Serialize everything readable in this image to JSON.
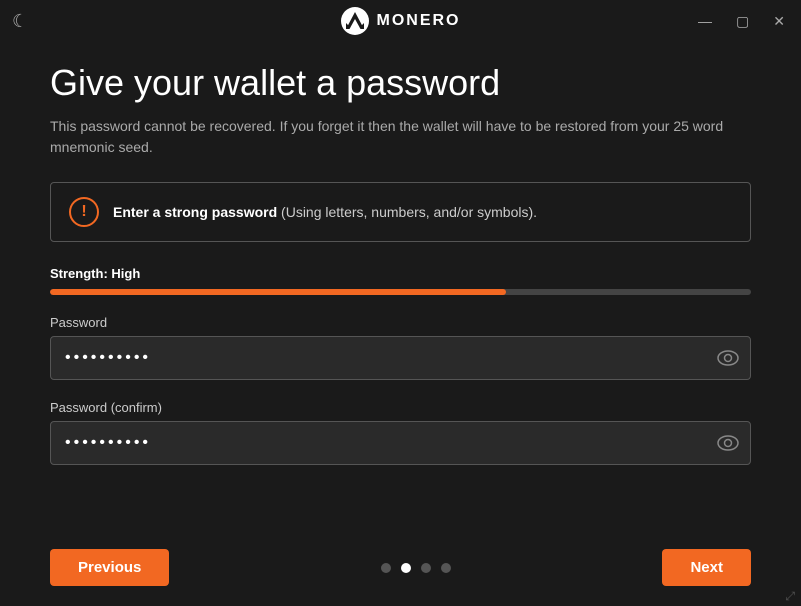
{
  "titleBar": {
    "appName": "MONERO",
    "minimizeLabel": "—",
    "maximizeLabel": "▢",
    "closeLabel": "✕"
  },
  "page": {
    "title": "Give your wallet a password",
    "subtitle": "This password cannot be recovered. If you forget it then the wallet will have to be restored from your 25 word mnemonic seed.",
    "warningText_strong": "Enter a strong password",
    "warningText_rest": " (Using letters, numbers, and/or symbols).",
    "strengthLabel": "Strength:",
    "strengthValue": "High",
    "strengthPercent": 65,
    "passwordLabel": "Password",
    "passwordConfirmLabel": "Password (confirm)",
    "passwordDots": "●●●●●●●●●●",
    "passwordConfirmDots": "●●●●●●●●●●"
  },
  "footer": {
    "previousLabel": "Previous",
    "nextLabel": "Next",
    "dots": [
      {
        "active": false
      },
      {
        "active": true
      },
      {
        "active": false
      },
      {
        "active": false
      }
    ]
  }
}
